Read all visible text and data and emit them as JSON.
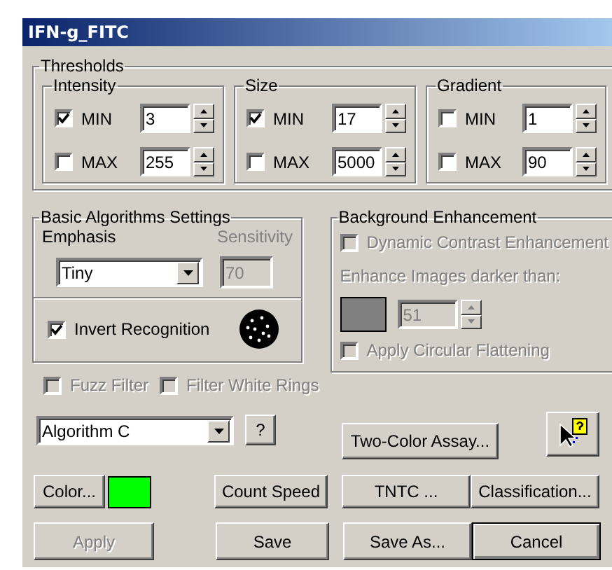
{
  "window": {
    "title": "IFN-g_FITC"
  },
  "thresholds": {
    "title": "Thresholds",
    "groups": [
      {
        "title": "Intensity",
        "rows": [
          {
            "label": "MIN",
            "checked": true,
            "value": "3"
          },
          {
            "label": "MAX",
            "checked": false,
            "value": "255"
          }
        ]
      },
      {
        "title": "Size",
        "rows": [
          {
            "label": "MIN",
            "checked": true,
            "value": "17"
          },
          {
            "label": "MAX",
            "checked": false,
            "value": "5000"
          }
        ]
      },
      {
        "title": "Gradient",
        "rows": [
          {
            "label": "MIN",
            "checked": false,
            "value": "1"
          },
          {
            "label": "MAX",
            "checked": false,
            "value": "90"
          }
        ]
      }
    ]
  },
  "basic_algorithms": {
    "title": "Basic Algorithms Settings",
    "emphasis": {
      "label": "Emphasis",
      "value": "Tiny"
    },
    "sensitivity": {
      "label": "Sensitivity",
      "value": "70",
      "disabled": true
    },
    "invert_recognition": {
      "label": "Invert Recognition",
      "checked": true
    }
  },
  "filters": [
    {
      "label": "Fuzz Filter",
      "checked": false,
      "disabled": true
    },
    {
      "label": "Filter White Rings",
      "checked": false,
      "disabled": true
    }
  ],
  "background_enhancement": {
    "title": "Background Enhancement",
    "dynamic_contrast": {
      "label": "Dynamic Contrast Enhancement",
      "checked": false,
      "disabled": true
    },
    "darker_than": {
      "label": "Enhance Images darker than:",
      "value": "51",
      "disabled": true
    },
    "circular_flattening": {
      "label": "Apply Circular Flattening",
      "checked": false,
      "disabled": true
    }
  },
  "algorithm": {
    "value": "Algorithm C",
    "help": "?"
  },
  "two_color_assay": {
    "label": "Two-Color Assay...",
    "disabled": false
  },
  "color": {
    "label": "Color...",
    "color": "#00ff00"
  },
  "buttons_row_1": [
    {
      "label": "Count Speed",
      "disabled": false,
      "default": false
    },
    {
      "label": "TNTC ...",
      "disabled": false,
      "default": false
    },
    {
      "label": "Classification...",
      "disabled": false,
      "default": false
    }
  ],
  "buttons_row_2": [
    {
      "label": "Apply",
      "disabled": true,
      "default": false
    },
    {
      "label": "Save",
      "disabled": false,
      "default": false
    },
    {
      "label": "Save As...",
      "disabled": false,
      "default": false
    },
    {
      "label": "Cancel",
      "disabled": false,
      "default": true
    }
  ]
}
